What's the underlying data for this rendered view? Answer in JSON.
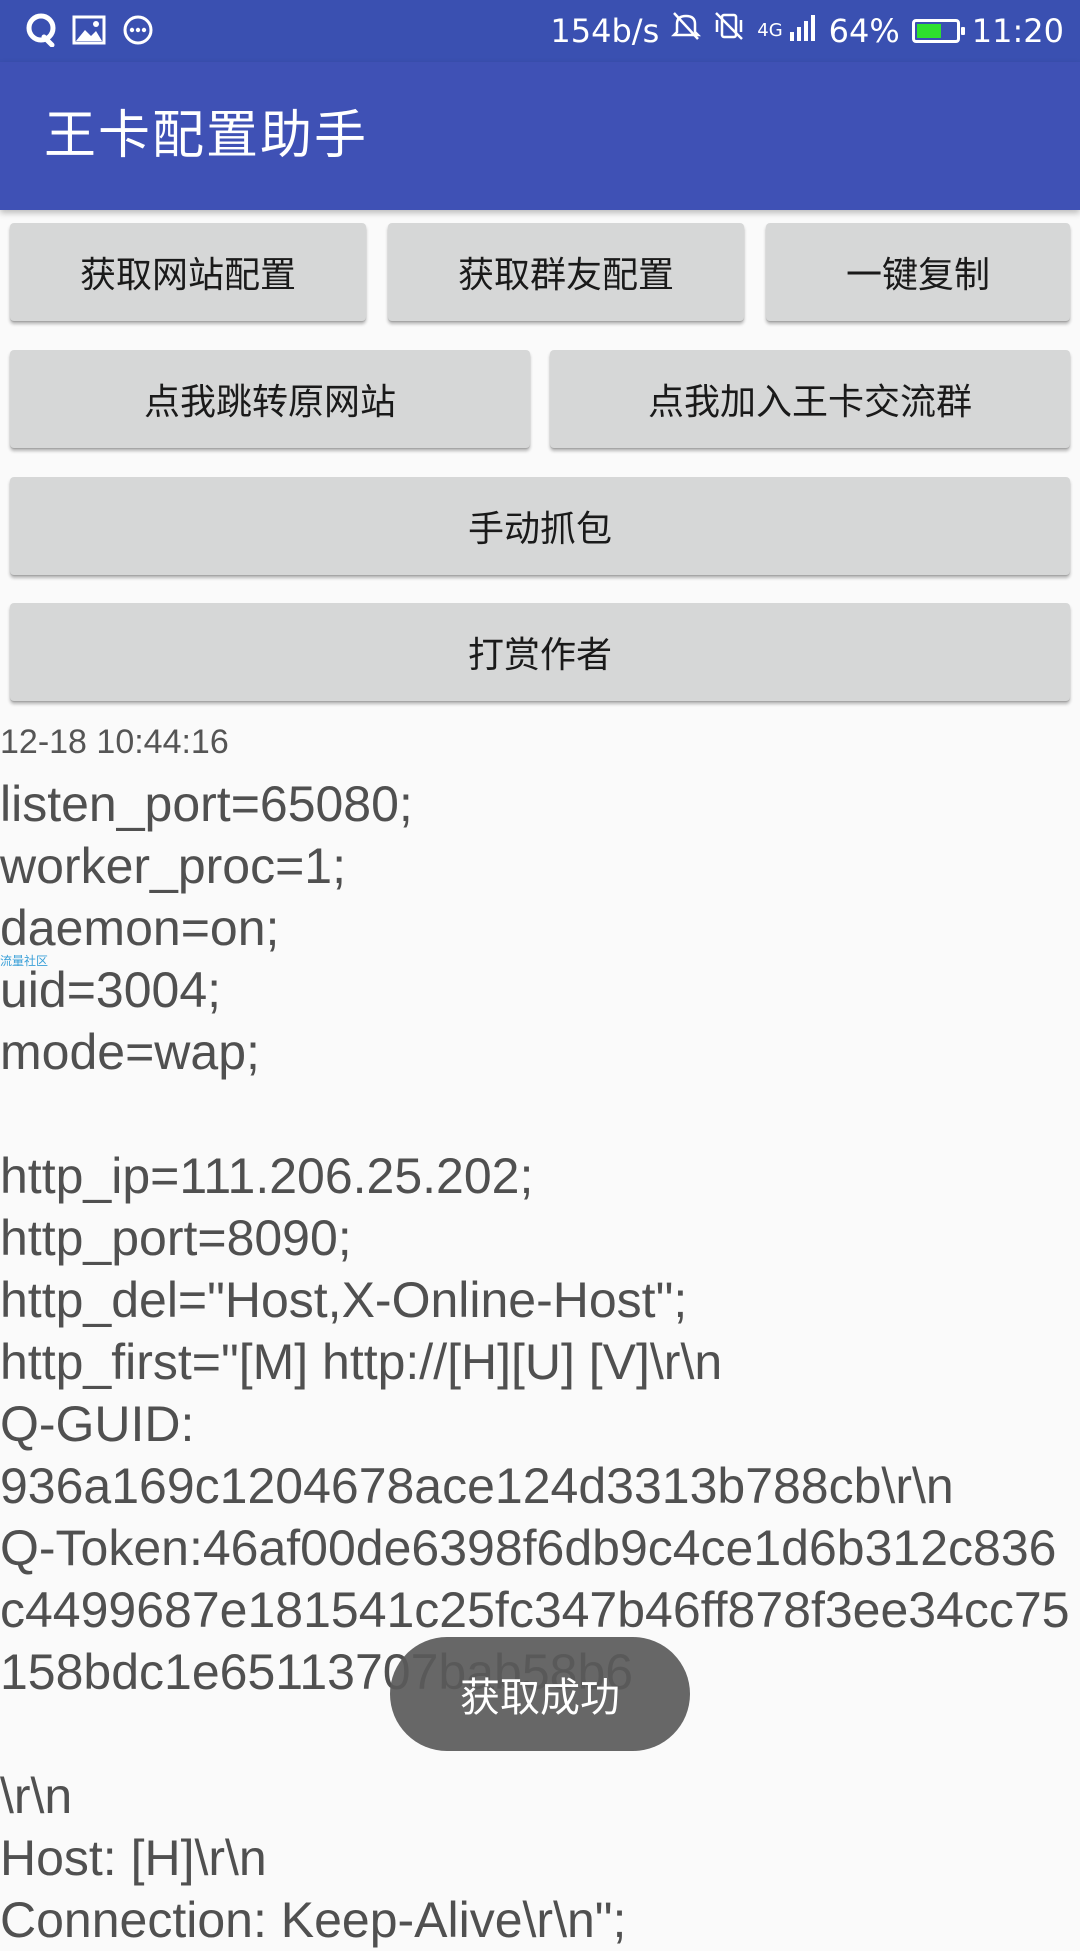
{
  "status_bar": {
    "speed": "154b/s",
    "network": "4G",
    "battery": "64%",
    "battery_level": 0.64,
    "time": "11:20",
    "battery_color": "#2ee02e"
  },
  "app_bar": {
    "title": "王卡配置助手",
    "color": "#3f51b5"
  },
  "buttons": {
    "get_site_config": "获取网站配置",
    "get_group_config": "获取群友配置",
    "copy_all": "一键复制",
    "goto_site": "点我跳转原网站",
    "join_group": "点我加入王卡交流群",
    "manual_capture": "手动抓包",
    "donate": "打赏作者"
  },
  "output": {
    "timestamp": "12-18 10:44:16",
    "watermark": "流量社区",
    "config_text": "listen_port=65080;\nworker_proc=1;\ndaemon=on;\nuid=3004;\nmode=wap;\n\nhttp_ip=111.206.25.202;\nhttp_port=8090;\nhttp_del=\"Host,X-Online-Host\";\nhttp_first=\"[M] http://[H][U] [V]\\r\\n\nQ-GUID:\n936a169c1204678ace124d3313b788cb\\r\\n\nQ-Token:46af00de6398f6db9c4ce1d6b312c836c4499687e181541c25fc347b46ff878f3ee34cc75158bdc1e65113707bab58b6\n\n\\r\\n\nHost: [H]\\r\\n\nConnection: Keep-Alive\\r\\n\";"
  },
  "toast": {
    "message": "获取成功"
  }
}
